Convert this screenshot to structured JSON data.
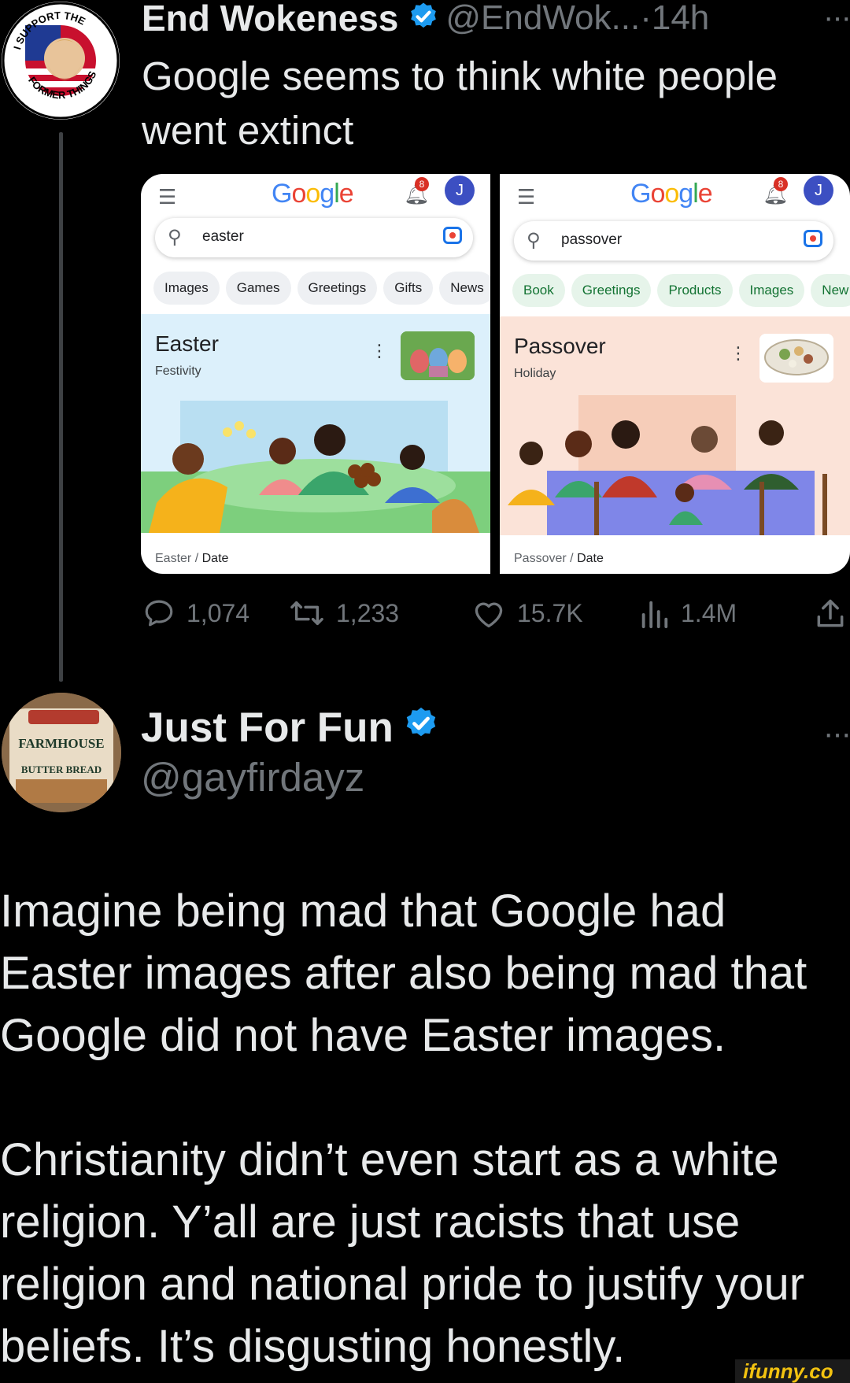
{
  "tweet1": {
    "author_name": "End Wokeness",
    "handle_time": "@EndWok...·14h",
    "more": "···",
    "text": "Google seems to think white people went extinct",
    "avatar_badge": {
      "top": "I SUPPORT THE",
      "bottom": "FORMER THINGS"
    }
  },
  "media": {
    "left": {
      "logo": "Google",
      "notif_count": "8",
      "avatar_initial": "J",
      "query": "easter",
      "chips": [
        "Images",
        "Games",
        "Greetings",
        "Gifts",
        "News"
      ],
      "kp_title": "Easter",
      "kp_subtitle": "Festivity",
      "crumb_a": "Easter",
      "crumb_sep": "/",
      "crumb_b": "Date"
    },
    "right": {
      "logo": "Google",
      "notif_count": "8",
      "avatar_initial": "J",
      "query": "passover",
      "chips": [
        "Book",
        "Greetings",
        "Products",
        "Images",
        "New"
      ],
      "kp_title": "Passover",
      "kp_subtitle": "Holiday",
      "crumb_a": "Passover",
      "crumb_sep": "/",
      "crumb_b": "Date"
    },
    "colors": {
      "easter_bg": "#dcf0fb",
      "passover_bg": "#fbe3d8",
      "chip_green": "#e6f4ea"
    }
  },
  "actions": {
    "replies": "1,074",
    "reposts": "1,233",
    "likes": "15.7K",
    "views": "1.4M"
  },
  "tweet2": {
    "author_name": "Just For Fun",
    "handle": "@gayfirdayz",
    "more": "···",
    "avatar_text": {
      "line1": "FARMHOUSE",
      "line2": "BUTTER BREAD"
    },
    "paragraph1": "Imagine being mad that Google had Easter images after also being mad that Google did not have Easter images.",
    "paragraph2": "Christianity didn’t even start as a white religion. Y’all are just racists that use religion and national pride to justify your beliefs. It’s disgusting honestly."
  },
  "watermark": "ifunny.co",
  "colors": {
    "background": "#000000",
    "text": "#e7e9ea",
    "muted": "#71767b",
    "verified": "#1d9bf0"
  }
}
